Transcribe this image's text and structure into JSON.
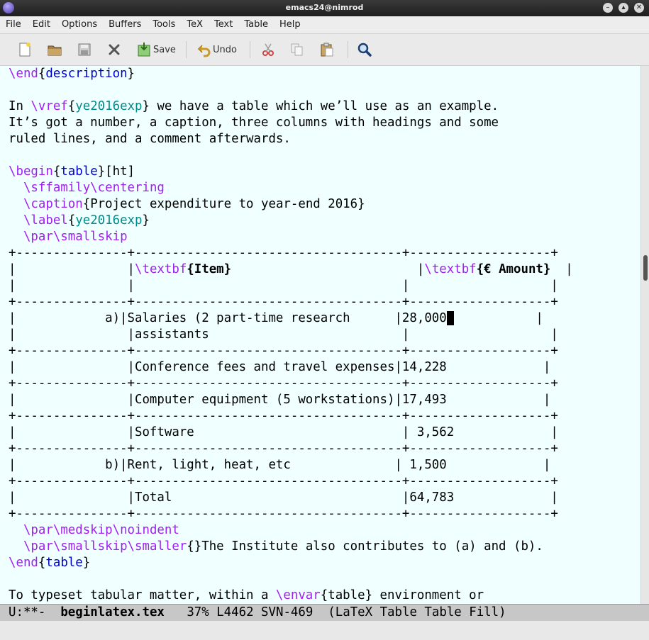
{
  "window": {
    "title": "emacs24@nimrod"
  },
  "menu": [
    "File",
    "Edit",
    "Options",
    "Buffers",
    "Tools",
    "TeX",
    "Text",
    "Table",
    "Help"
  ],
  "toolbar": {
    "save_label": "Save",
    "undo_label": "Undo"
  },
  "buffer": {
    "lines": [
      [
        {
          "t": "\\end",
          "c": "kw"
        },
        {
          "t": "{"
        },
        {
          "t": "description",
          "c": "br"
        },
        {
          "t": "}"
        }
      ],
      [],
      [
        {
          "t": "In "
        },
        {
          "t": "\\vref",
          "c": "kw"
        },
        {
          "t": "{"
        },
        {
          "t": "ye2016exp",
          "c": "ref"
        },
        {
          "t": "} we have a table which we’ll use as an example."
        }
      ],
      [
        {
          "t": "It’s got a number, a caption, three columns with headings and some"
        }
      ],
      [
        {
          "t": "ruled lines, and a comment afterwards."
        }
      ],
      [],
      [
        {
          "t": "\\begin",
          "c": "kw"
        },
        {
          "t": "{"
        },
        {
          "t": "table",
          "c": "br"
        },
        {
          "t": "}[ht]"
        }
      ],
      [
        {
          "t": "  "
        },
        {
          "t": "\\sffamily\\centering",
          "c": "kw"
        }
      ],
      [
        {
          "t": "  "
        },
        {
          "t": "\\caption",
          "c": "kw"
        },
        {
          "t": "{Project expenditure to year-end 2016}"
        }
      ],
      [
        {
          "t": "  "
        },
        {
          "t": "\\label",
          "c": "kw"
        },
        {
          "t": "{"
        },
        {
          "t": "ye2016exp",
          "c": "ref"
        },
        {
          "t": "}"
        }
      ],
      [
        {
          "t": "  "
        },
        {
          "t": "\\par\\smallskip",
          "c": "kw"
        }
      ],
      [
        {
          "t": "+---------------+------------------------------------+-------------------+"
        }
      ],
      [
        {
          "t": "|               |"
        },
        {
          "t": "\\textbf",
          "c": "kw"
        },
        {
          "t": "{Item}",
          "c": "bold"
        },
        {
          "t": "                         |"
        },
        {
          "t": "\\textbf",
          "c": "kw"
        },
        {
          "t": "{€ Amount}",
          "c": "bold"
        },
        {
          "t": "  |"
        }
      ],
      [
        {
          "t": "|               |                                    |                   |"
        }
      ],
      [
        {
          "t": "+---------------+------------------------------------+-------------------+"
        }
      ],
      [
        {
          "t": "|            a)|Salaries (2 part-time research      |28,000"
        },
        {
          "t": " ",
          "c": "cursor"
        },
        {
          "t": "           |"
        }
      ],
      [
        {
          "t": "|               |assistants                          |                   |"
        }
      ],
      [
        {
          "t": "+---------------+------------------------------------+-------------------+"
        }
      ],
      [
        {
          "t": "|               |Conference fees and travel expenses|14,228             |"
        }
      ],
      [
        {
          "t": "+---------------+------------------------------------+-------------------+"
        }
      ],
      [
        {
          "t": "|               |Computer equipment (5 workstations)|17,493             |"
        }
      ],
      [
        {
          "t": "+---------------+------------------------------------+-------------------+"
        }
      ],
      [
        {
          "t": "|               |Software                            | 3,562             |"
        }
      ],
      [
        {
          "t": "+---------------+------------------------------------+-------------------+"
        }
      ],
      [
        {
          "t": "|            b)|Rent, light, heat, etc              | 1,500             |"
        }
      ],
      [
        {
          "t": "+---------------+------------------------------------+-------------------+"
        }
      ],
      [
        {
          "t": "|               |Total                               |64,783             |"
        }
      ],
      [
        {
          "t": "+---------------+------------------------------------+-------------------+"
        }
      ],
      [
        {
          "t": "  "
        },
        {
          "t": "\\par\\medskip\\noindent",
          "c": "kw"
        }
      ],
      [
        {
          "t": "  "
        },
        {
          "t": "\\par\\smallskip\\smaller",
          "c": "kw"
        },
        {
          "t": "{}The Institute also contributes to (a) and (b)."
        }
      ],
      [
        {
          "t": "\\end",
          "c": "kw"
        },
        {
          "t": "{"
        },
        {
          "t": "table",
          "c": "br"
        },
        {
          "t": "}"
        }
      ],
      [],
      [
        {
          "t": "To typeset tabular matter, within a "
        },
        {
          "t": "\\envar",
          "c": "kw"
        },
        {
          "t": "{table} environment or"
        }
      ]
    ]
  },
  "modeline": {
    "status": "U:**-",
    "buffer_name": "beginlatex.tex",
    "position": "37% L4462",
    "vc": "SVN-469",
    "modes": "(LaTeX Table Table Fill)"
  }
}
